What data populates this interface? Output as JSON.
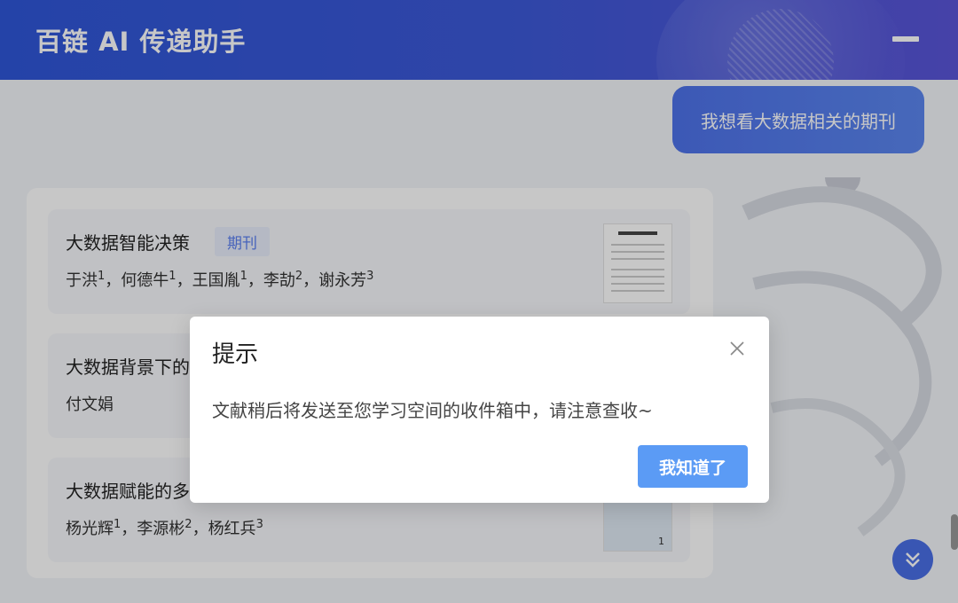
{
  "header": {
    "title": "百链 AI 传递助手"
  },
  "chat": {
    "user_message": "我想看大数据相关的期刊"
  },
  "results": [
    {
      "title": "大数据智能决策",
      "tag": "期刊",
      "authors": [
        {
          "name": "于洪",
          "sup": "1"
        },
        {
          "name": "何德牛",
          "sup": "1"
        },
        {
          "name": "王国胤",
          "sup": "1"
        },
        {
          "name": "李劼",
          "sup": "2"
        },
        {
          "name": "谢永芳",
          "sup": "3"
        }
      ]
    },
    {
      "title": "大数据背景下的",
      "authors_text": "付文娟"
    },
    {
      "title": "大数据赋能的多",
      "authors": [
        {
          "name": "杨光辉",
          "sup": "1"
        },
        {
          "name": "李源彬",
          "sup": "2"
        },
        {
          "name": "杨红兵",
          "sup": "3"
        }
      ],
      "thumb_page": "1"
    }
  ],
  "dialog": {
    "title": "提示",
    "message": "文献稍后将发送至您学习空间的收件箱中，请注意查收~",
    "ok_label": "我知道了"
  },
  "icons": {
    "close": "close-icon",
    "scroll_down": "chevron-double-down-icon",
    "minimize": "minimize-icon"
  },
  "colors": {
    "header_start": "#2f57d8",
    "accent": "#5b9bf5",
    "tag_bg": "#e8eefb"
  }
}
